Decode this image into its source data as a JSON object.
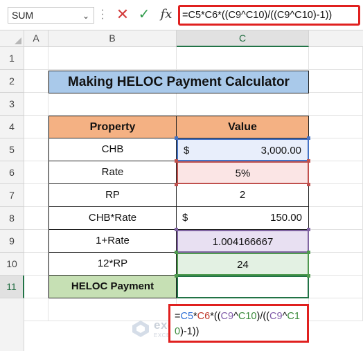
{
  "formula_bar": {
    "name_box": "SUM",
    "formula": "=C5*C6*((C9^C10)/((C9^C10)-1))"
  },
  "columns": [
    "A",
    "B",
    "C"
  ],
  "rows": [
    "1",
    "2",
    "3",
    "4",
    "5",
    "6",
    "7",
    "8",
    "9",
    "10",
    "11"
  ],
  "sheet": {
    "title": "Making HELOC Payment Calculator",
    "header_property": "Property",
    "header_value": "Value",
    "rows": [
      {
        "label": "CHB",
        "value_prefix": "$",
        "value": "3,000.00"
      },
      {
        "label": "Rate",
        "value_prefix": "",
        "value": "5%"
      },
      {
        "label": "RP",
        "value_prefix": "",
        "value": "2"
      },
      {
        "label": "CHB*Rate",
        "value_prefix": "$",
        "value": "150.00"
      },
      {
        "label": "1+Rate",
        "value_prefix": "",
        "value": "1.004166667"
      },
      {
        "label": "12*RP",
        "value_prefix": "",
        "value": "24"
      }
    ],
    "result_label": "HELOC Payment"
  },
  "callout_formula": {
    "p1": "=",
    "p2": "C5",
    "p3": "*",
    "p4": "C6",
    "p5": "*((",
    "p6": "C9",
    "p7": "^",
    "p8": "C10",
    "p9": ")/((",
    "p10": "C9",
    "p11": "^",
    "p12": "C10",
    "p13": ")-1))"
  },
  "watermark": {
    "name": "exceldemy",
    "tagline": "EXCEL · DATA · BI"
  },
  "colors": {
    "title_fill": "#a9c9ea",
    "header_fill": "#f4b183",
    "result_label_fill": "#c6e0b4",
    "highlight_red": "#e0201f",
    "ref_blue": "#4472c4",
    "ref_red": "#c0504d",
    "ref_purple": "#8064a2",
    "ref_green": "#4e9a4e"
  }
}
